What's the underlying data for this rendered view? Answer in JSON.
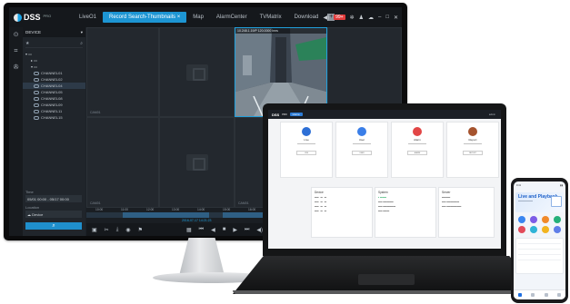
{
  "monitor": {
    "app": {
      "name": "DSS",
      "suffix": "PRO"
    },
    "tabs": [
      {
        "label": "LiveO1",
        "active": false
      },
      {
        "label": "Record Search-Thumbnails",
        "active": true,
        "close": "×"
      },
      {
        "label": "Map",
        "active": false
      },
      {
        "label": "AlarmCenter",
        "active": false
      },
      {
        "label": "TVMatrix",
        "active": false
      },
      {
        "label": "Download",
        "active": false
      }
    ],
    "topbar": {
      "alarm_count": "99+"
    },
    "panel": {
      "header": "DEVICE",
      "tree": [
        {
          "label": "CHANNEL01",
          "selected": false
        },
        {
          "label": "CHANNEL02",
          "selected": false
        },
        {
          "label": "CHANNEL04",
          "selected": true
        },
        {
          "label": "CHANNEL05",
          "selected": false
        },
        {
          "label": "CHANNEL08",
          "selected": false
        },
        {
          "label": "CHANNEL09",
          "selected": false
        },
        {
          "label": "CHANNEL11",
          "selected": false
        },
        {
          "label": "CHANNEL15",
          "selected": false
        }
      ],
      "time_label": "Time",
      "time_value": "05/01 00:00 - 05/17 00:00",
      "location_label": "Location",
      "location_value": "Device"
    },
    "cells": [
      {
        "label": "CAM01",
        "selected": false
      },
      {
        "label": "",
        "selected": false
      },
      {
        "label": "",
        "title": "10.248.1.19/P 120.0000 Inns",
        "selected": true
      },
      {
        "label": "CAM01",
        "selected": false
      },
      {
        "label": "",
        "selected": false
      },
      {
        "label": "CAM01",
        "selected": false
      }
    ],
    "timeline": {
      "ticks": [
        "10:00",
        "11:00",
        "12:00",
        "13:00",
        "14:00",
        "15:00",
        "16:00"
      ],
      "current": "2016-07-17 14:21:23"
    }
  },
  "laptop": {
    "app": {
      "name": "DSS",
      "suffix": "PRO"
    },
    "tab": "Home",
    "user": "admin",
    "cards": [
      {
        "title": "Live",
        "color": "#2d6fd6",
        "button": "LIVE"
      },
      {
        "title": "User",
        "color": "#3a7ee8",
        "button": "USER"
      },
      {
        "title": "Alarm",
        "color": "#e24646",
        "button": "ALARM"
      },
      {
        "title": "Report",
        "color": "#a5532e",
        "button": "REPORT"
      }
    ],
    "panels": {
      "device": {
        "header": "Device"
      },
      "system": {
        "header": "System"
      },
      "server": {
        "header": "Server"
      }
    }
  },
  "phone": {
    "status_time": "9:41",
    "banner_title": "Live and Playback",
    "apps": [
      {
        "color": "#3a85f0"
      },
      {
        "color": "#7c5ce6"
      },
      {
        "color": "#f08a2a"
      },
      {
        "color": "#25b07a"
      },
      {
        "color": "#e24b5a"
      },
      {
        "color": "#2fb3d7"
      },
      {
        "color": "#f2b420"
      },
      {
        "color": "#5f7ee8"
      }
    ]
  }
}
